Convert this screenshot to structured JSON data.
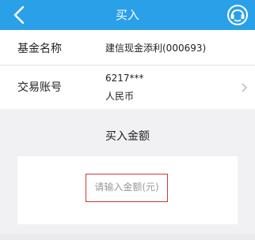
{
  "header": {
    "title": "买入"
  },
  "fund": {
    "label": "基金名称",
    "value": "建信现金添利(000693)"
  },
  "account": {
    "label": "交易账号",
    "number": "6217***",
    "currency": "人民币"
  },
  "buy": {
    "section_title": "买入金额",
    "amount_placeholder": "请输入金额(元)"
  }
}
